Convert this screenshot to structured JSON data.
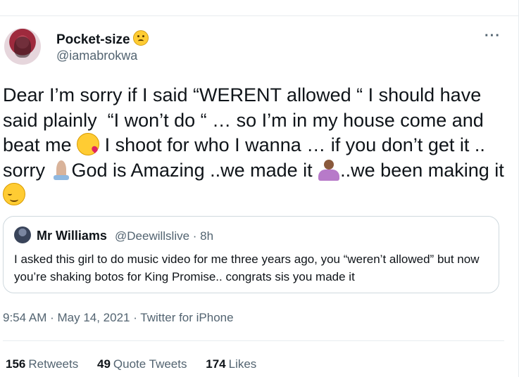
{
  "author": {
    "display_name": "Pocket-size",
    "name_emoji": "face-with-rolling-eyes-emoji",
    "handle": "@iamabrokwa"
  },
  "menu_icon": "more-options-icon",
  "tweet": {
    "segments": [
      "Dear I’m sorry if I said “WERENT allowed “ I should have said plainly  “I won’t do “ … so I’m in my house come and beat me ",
      " I shoot for who I wanna … if you don’t get it .. sorry ",
      "God is Amazing ..we made it ",
      "..we been making it "
    ],
    "emojis": [
      "kissing-heart-emoji",
      "folded-hands-emoji",
      "person-shrugging-emoji",
      "relieved-face-emoji"
    ]
  },
  "quoted_tweet": {
    "display_name": "Mr Williams",
    "meta": "@Deewillslive · 8h",
    "text": "I asked this girl to do music video for me three years ago, you “weren’t allowed” but now you’re shaking botos for King Promise.. congrats sis you made it"
  },
  "timestamp": "9:54 AM · May 14, 2021 · Twitter for iPhone",
  "stats": {
    "retweets": {
      "count": "156",
      "label": "Retweets"
    },
    "quote_tweets": {
      "count": "49",
      "label": "Quote Tweets"
    },
    "likes": {
      "count": "174",
      "label": "Likes"
    }
  },
  "colors": {
    "text": "#0f1419",
    "secondary": "#536471",
    "border": "#cfd9de"
  }
}
